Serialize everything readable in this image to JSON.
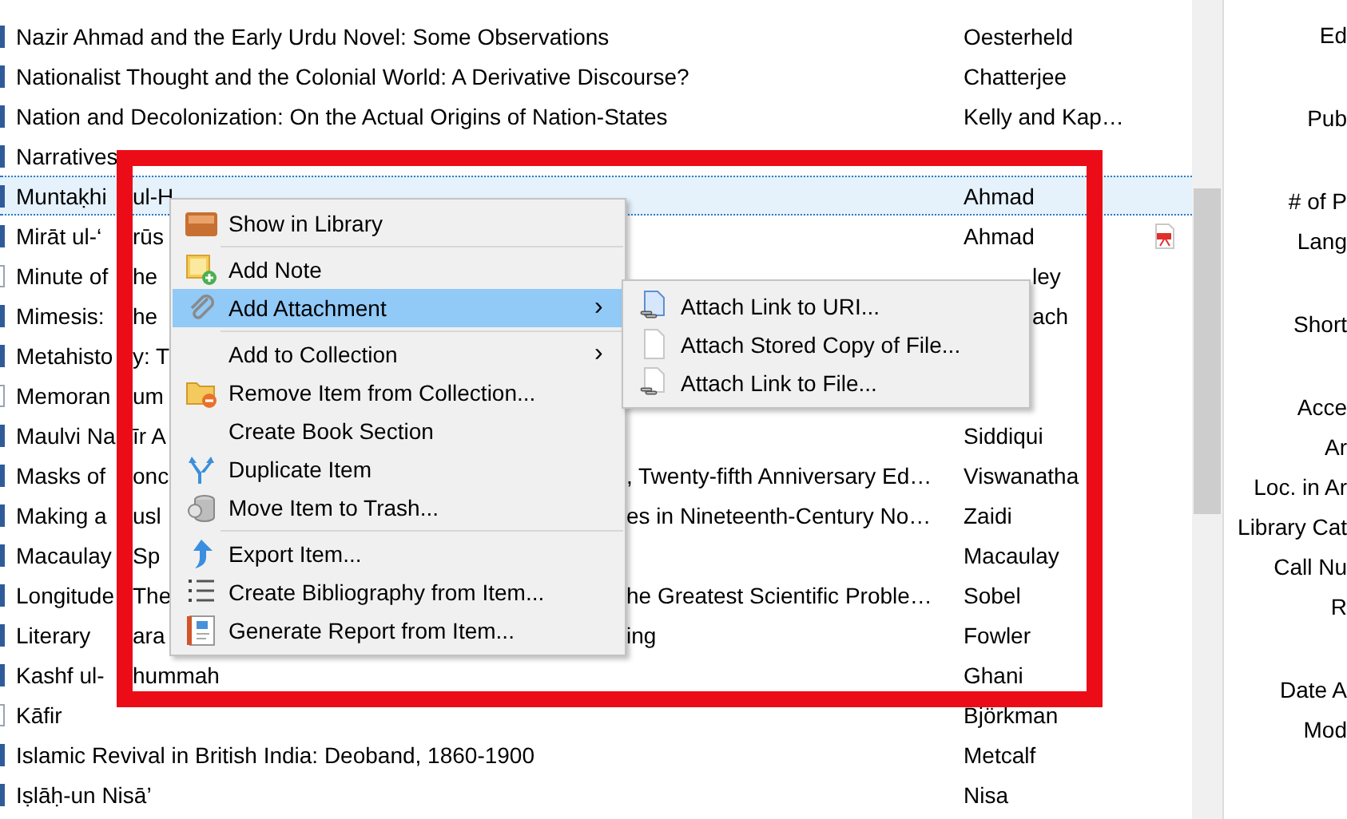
{
  "items_list": {
    "rows": [
      {
        "title": "Nazir Ahmad and the Early Urdu Novel: Some Observations",
        "author": "Oesterheld",
        "kind": "book",
        "pdf": false,
        "selected": false
      },
      {
        "title": "Nationalist Thought and the Colonial World: A Derivative Discourse?",
        "author": "Chatterjee",
        "kind": "book",
        "pdf": false,
        "selected": false
      },
      {
        "title": "Nation and Decolonization: On the Actual Origins of Nation-States",
        "author": "Kelly and Kap…",
        "kind": "book",
        "pdf": false,
        "selected": false
      },
      {
        "title": "Narratives",
        "kind": "book",
        "pdf": false,
        "selected": false
      },
      {
        "title": "Muntaḳhi",
        "title_mid": "ul-H",
        "author": "Ahmad",
        "kind": "book",
        "pdf": false,
        "selected": true
      },
      {
        "title": "Mirāt ul-‘",
        "title_mid": "rūs",
        "author": "Ahmad",
        "kind": "book",
        "pdf": true,
        "selected": false
      },
      {
        "title": "Minute of",
        "title_mid": "he",
        "author_tail": "ley",
        "kind": "document",
        "pdf": false,
        "selected": false
      },
      {
        "title": "Mimesis:",
        "title_mid": "he",
        "author_tail": "ach",
        "kind": "book",
        "pdf": false,
        "selected": false
      },
      {
        "title": "Metahisto",
        "title_mid": "y: T",
        "kind": "book",
        "pdf": false,
        "selected": false
      },
      {
        "title": "Memoran",
        "title_mid": "um",
        "kind": "document",
        "pdf": false,
        "selected": false
      },
      {
        "title": "Maulvi Na",
        "title_mid": "īr A",
        "author": "Siddiqui",
        "kind": "book",
        "pdf": false,
        "selected": false
      },
      {
        "title": "Masks of",
        "title_mid": "onc",
        "title_tail": ", Twenty-fifth Anniversary Ed…",
        "author": "Viswanatha",
        "kind": "book",
        "pdf": false,
        "selected": false
      },
      {
        "title": "Making a",
        "title_mid": "usl",
        "title_tail": "es in Nineteenth-Century No…",
        "author": "Zaidi",
        "kind": "book",
        "pdf": false,
        "selected": false
      },
      {
        "title": "Macaulay",
        "title_mid": "Sp",
        "author": "Macaulay",
        "kind": "book",
        "pdf": false,
        "selected": false
      },
      {
        "title": "Longitude",
        "title_mid": "The",
        "title_tail": "he Greatest Scientific Proble…",
        "author": "Sobel",
        "kind": "book",
        "pdf": false,
        "selected": false
      },
      {
        "title": "Literary",
        "title_mid": "ara",
        "title_tail": "ing",
        "author": "Fowler",
        "kind": "book",
        "pdf": false,
        "selected": false
      },
      {
        "title": "Kashf ul-",
        "title_mid": "hummah",
        "author": "Ghani",
        "kind": "book",
        "pdf": false,
        "selected": false
      },
      {
        "title": "Kāfir",
        "author": "Björkman",
        "kind": "document",
        "pdf": false,
        "selected": false
      },
      {
        "title": "Islamic Revival in British India: Deoband, 1860-1900",
        "author": "Metcalf",
        "kind": "book",
        "pdf": false,
        "selected": false
      },
      {
        "title": "Iṣlāḥ-un Nisā’",
        "author": "Nisa",
        "kind": "book",
        "pdf": false,
        "selected": false
      }
    ]
  },
  "item_pane": {
    "fields": [
      {
        "label": "Ed",
        "multiline": true
      },
      {
        "label": "Pub",
        "multiline": true
      },
      {
        "label": "# of P",
        "multiline": false
      },
      {
        "label": "Lang",
        "multiline": true
      },
      {
        "label": "Short",
        "multiline": true
      },
      {
        "label": "Acce",
        "multiline": false
      },
      {
        "label": "Ar",
        "multiline": false
      },
      {
        "label": "Loc. in Ar",
        "multiline": false
      },
      {
        "label": "Library Cat",
        "multiline": false
      },
      {
        "label": "Call Nu",
        "multiline": false
      },
      {
        "label": "R",
        "multiline": true
      },
      {
        "label": "Date A",
        "multiline": false
      },
      {
        "label": "Mod",
        "multiline": false
      }
    ]
  },
  "context_menu": {
    "items": [
      {
        "kind": "item",
        "label": "Show in Library",
        "selected": false
      },
      {
        "kind": "separator"
      },
      {
        "kind": "item",
        "label": "Add Note",
        "selected": false
      },
      {
        "kind": "item",
        "label": "Add Attachment",
        "arrow": "›",
        "selected": true
      },
      {
        "kind": "separator"
      },
      {
        "kind": "item",
        "label": "Add to Collection",
        "arrow": "›",
        "selected": false
      },
      {
        "kind": "item",
        "label": "Remove Item from Collection...",
        "selected": false
      },
      {
        "kind": "item",
        "label": "Create Book Section",
        "selected": false
      },
      {
        "kind": "item",
        "label": "Duplicate Item",
        "selected": false
      },
      {
        "kind": "item",
        "label": "Move Item to Trash...",
        "selected": false
      },
      {
        "kind": "separator"
      },
      {
        "kind": "item",
        "label": "Export Item...",
        "selected": false
      },
      {
        "kind": "item",
        "label": "Create Bibliography from Item...",
        "selected": false
      },
      {
        "kind": "item",
        "label": "Generate Report from Item...",
        "selected": false
      }
    ]
  },
  "submenu": {
    "items": [
      {
        "label": "Attach Link to URI...",
        "selected": false
      },
      {
        "label": "Attach Stored Copy of File...",
        "selected": false
      },
      {
        "label": "Attach Link to File...",
        "selected": false
      }
    ]
  },
  "highlight_frame": {
    "visible": true
  }
}
